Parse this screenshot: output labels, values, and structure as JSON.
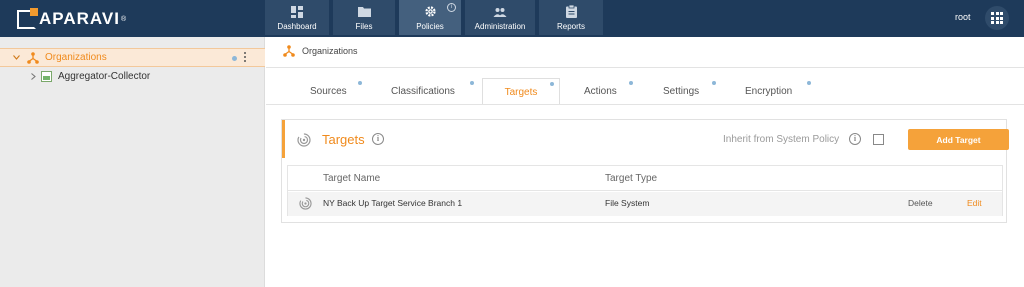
{
  "app": {
    "logo_text": "APARAVI",
    "logo_reg": "®"
  },
  "nav": {
    "items": [
      {
        "label": "Dashboard",
        "icon": "dashboard-icon"
      },
      {
        "label": "Files",
        "icon": "folder-icon"
      },
      {
        "label": "Policies",
        "icon": "gear-icon",
        "active": true
      },
      {
        "label": "Administration",
        "icon": "users-icon"
      },
      {
        "label": "Reports",
        "icon": "clipboard-icon"
      }
    ],
    "info_badge": "i"
  },
  "user": {
    "name": "root",
    "apps_icon": "apps-grid-icon"
  },
  "sidebar": {
    "items": [
      {
        "label": "Organizations",
        "icon": "organization-icon",
        "expanded": true,
        "selected": true
      },
      {
        "label": "Aggregator-Collector",
        "icon": "aggregator-icon",
        "expanded": false
      }
    ]
  },
  "breadcrumb": {
    "label": "Organizations",
    "icon": "organization-icon"
  },
  "tabs": {
    "items": [
      {
        "label": "Sources"
      },
      {
        "label": "Classifications"
      },
      {
        "label": "Targets",
        "active": true
      },
      {
        "label": "Actions"
      },
      {
        "label": "Settings"
      },
      {
        "label": "Encryption"
      }
    ]
  },
  "panel": {
    "title": "Targets",
    "info": "i",
    "inherit_label": "Inherit from System Policy",
    "inherit_checked": false,
    "add_button": "Add Target"
  },
  "table": {
    "headers": [
      "Target Name",
      "Target Type"
    ],
    "rows": [
      {
        "name": "NY Back Up Target Service Branch 1",
        "type": "File System",
        "delete": "Delete",
        "edit": "Edit"
      }
    ]
  },
  "colors": {
    "topbar": "#1e3a5a",
    "accent": "#f08a1c",
    "button": "#f5a23a",
    "sidebar_bg": "#ebebeb",
    "selected_row": "#fbe9d7"
  }
}
